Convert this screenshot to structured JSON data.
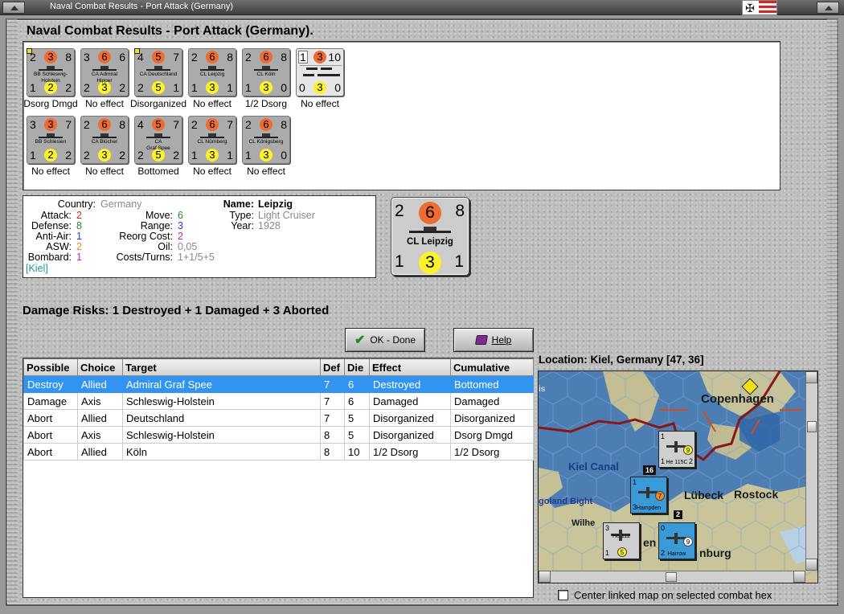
{
  "window": {
    "title": "Naval Combat Results - Port Attack (Germany)"
  },
  "header": {
    "title": "Naval Combat Results - Port Attack (Germany)."
  },
  "units": [
    {
      "att_left": "2",
      "attack": "3",
      "att_right": "8",
      "def_left": "1",
      "defense": "2",
      "def_right": "2",
      "name": "BB Schleswig-\nHolstein",
      "effect": "Dsorg Dmgd",
      "marker": true
    },
    {
      "att_left": "3",
      "attack": "6",
      "att_right": "6",
      "def_left": "2",
      "defense": "3",
      "def_right": "2",
      "name": "CA Admiral\nHipper",
      "effect": "No effect",
      "marker": false
    },
    {
      "att_left": "4",
      "attack": "5",
      "att_right": "7",
      "def_left": "2",
      "defense": "5",
      "def_right": "1",
      "name": "CA Deutschland",
      "effect": "Disorganized",
      "marker": true
    },
    {
      "att_left": "2",
      "attack": "6",
      "att_right": "8",
      "def_left": "1",
      "defense": "3",
      "def_right": "1",
      "name": "CL Leipzig",
      "effect": "No effect",
      "marker": false,
      "selected": true
    },
    {
      "att_left": "2",
      "attack": "6",
      "att_right": "8",
      "def_left": "1",
      "defense": "3",
      "def_right": "0",
      "name": "CL Köln",
      "effect": "1/2 Dsorg",
      "marker": false
    },
    {
      "att_left": "1",
      "attack": "3",
      "att_right": "10",
      "def_left": "0",
      "defense": "3",
      "def_right": "0",
      "name": "",
      "effect": "No effect",
      "marker": false,
      "group": true
    },
    {
      "att_left": "3",
      "attack": "3",
      "att_right": "7",
      "def_left": "1",
      "defense": "2",
      "def_right": "2",
      "name": "BB Schlesien",
      "effect": "No effect",
      "marker": false
    },
    {
      "att_left": "2",
      "attack": "6",
      "att_right": "8",
      "def_left": "2",
      "defense": "3",
      "def_right": "2",
      "name": "CA Blücher",
      "effect": "No effect",
      "marker": false
    },
    {
      "att_left": "4",
      "attack": "5",
      "att_right": "7",
      "def_left": "2",
      "defense": "5",
      "def_right": "2",
      "name": "CA\nGraf Spee",
      "effect": "Bottomed",
      "marker": false
    },
    {
      "att_left": "2",
      "attack": "6",
      "att_right": "7",
      "def_left": "1",
      "defense": "3",
      "def_right": "1",
      "name": "CL Nürnberg",
      "effect": "No effect",
      "marker": false
    },
    {
      "att_left": "2",
      "attack": "6",
      "att_right": "8",
      "def_left": "1",
      "defense": "3",
      "def_right": "0",
      "name": "CL Königsberg",
      "effect": "No effect",
      "marker": false
    }
  ],
  "info": {
    "labels": {
      "country": "Country:",
      "attack": "Attack:",
      "defense": "Defense:",
      "antiair": "Anti-Air:",
      "asw": "ASW:",
      "bombard": "Bombard:",
      "move": "Move:",
      "range": "Range:",
      "reorg": "Reorg Cost:",
      "oil": "Oil:",
      "costs": "Costs/Turns:",
      "name": "Name:",
      "type": "Type:",
      "year": "Year:"
    },
    "country": "Germany",
    "attack": "2",
    "defense": "8",
    "antiair": "1",
    "asw": "2",
    "bombard": "1",
    "move": "6",
    "range": "3",
    "reorg": "2",
    "oil": "0,05",
    "costs": "1+1/5+5",
    "name": "Leipzig",
    "type": "Light Cruiser",
    "year": "1928",
    "location": "[Kiel]"
  },
  "big_counter": {
    "tl": "2",
    "attack": "6",
    "tr": "8",
    "name": "CL Leipzig",
    "bl": "1",
    "defense": "3",
    "br": "1"
  },
  "damage_risks": "Damage Risks: 1 Destroyed + 1 Damaged + 3 Aborted",
  "buttons": {
    "ok": "OK - Done",
    "help": "Help"
  },
  "table": {
    "headers": [
      "Possible",
      "Choice",
      "Target",
      "Def",
      "Die",
      "Effect",
      "Cumulative"
    ],
    "rows": [
      [
        "Destroy",
        "Allied",
        "Admiral Graf Spee",
        "7",
        "6",
        "Destroyed",
        "Bottomed"
      ],
      [
        "Damage",
        "Axis",
        "Schleswig-Holstein",
        "7",
        "6",
        "Damaged",
        "Damaged"
      ],
      [
        "Abort",
        "Allied",
        "Deutschland",
        "7",
        "5",
        "Disorganized",
        "Disorganized"
      ],
      [
        "Abort",
        "Axis",
        "Schleswig-Holstein",
        "8",
        "5",
        "Disorganized",
        "Dsorg Dmgd"
      ],
      [
        "Abort",
        "Allied",
        "Köln",
        "8",
        "10",
        "1/2 Dsorg",
        "1/2 Dsorg"
      ]
    ]
  },
  "location": "Location:  Kiel, Germany [47, 36]",
  "map": {
    "labels": {
      "copenhagen": "Copenhagen",
      "kiel_canal": "Kiel Canal",
      "lubeck": "Lübeck",
      "rostock": "Rostock",
      "heligoland": "goland Bight",
      "wilhelm": "Wilhe",
      "hamburg": "nburg",
      "edge": "is",
      "en": "en"
    },
    "units": {
      "he115": {
        "tl": "1",
        "tr": "2",
        "bl": "1",
        "br": "2",
        "name": "He 115C",
        "badge": "9"
      },
      "hampden": {
        "tl": "1",
        "tr": "",
        "bl": "3",
        "br": "",
        "name": "Hampden",
        "badge": "7"
      },
      "he112": {
        "tl": "3",
        "tr": "",
        "bl": "1",
        "br": "",
        "name": "He 112",
        "badge": "5"
      },
      "harrow": {
        "tl": "0",
        "tr": "",
        "bl": "2",
        "br": "",
        "name": "Harrow",
        "badge": "9"
      }
    },
    "stack_count": "16",
    "stack_count2": "2"
  },
  "center_checkbox": "Center linked map on selected combat hex",
  "colors": {
    "selection": "#3294f0",
    "attack": "#ef6b34",
    "defense": "#fbf22a",
    "red_text": "#d42a2a",
    "green_text": "#2a8a2a",
    "blue_text": "#2a3ac4",
    "orange_text": "#e88a1a",
    "purple_text": "#b42ab4",
    "grey_text": "#8a8a8a",
    "teal_text": "#1f9a8a"
  }
}
